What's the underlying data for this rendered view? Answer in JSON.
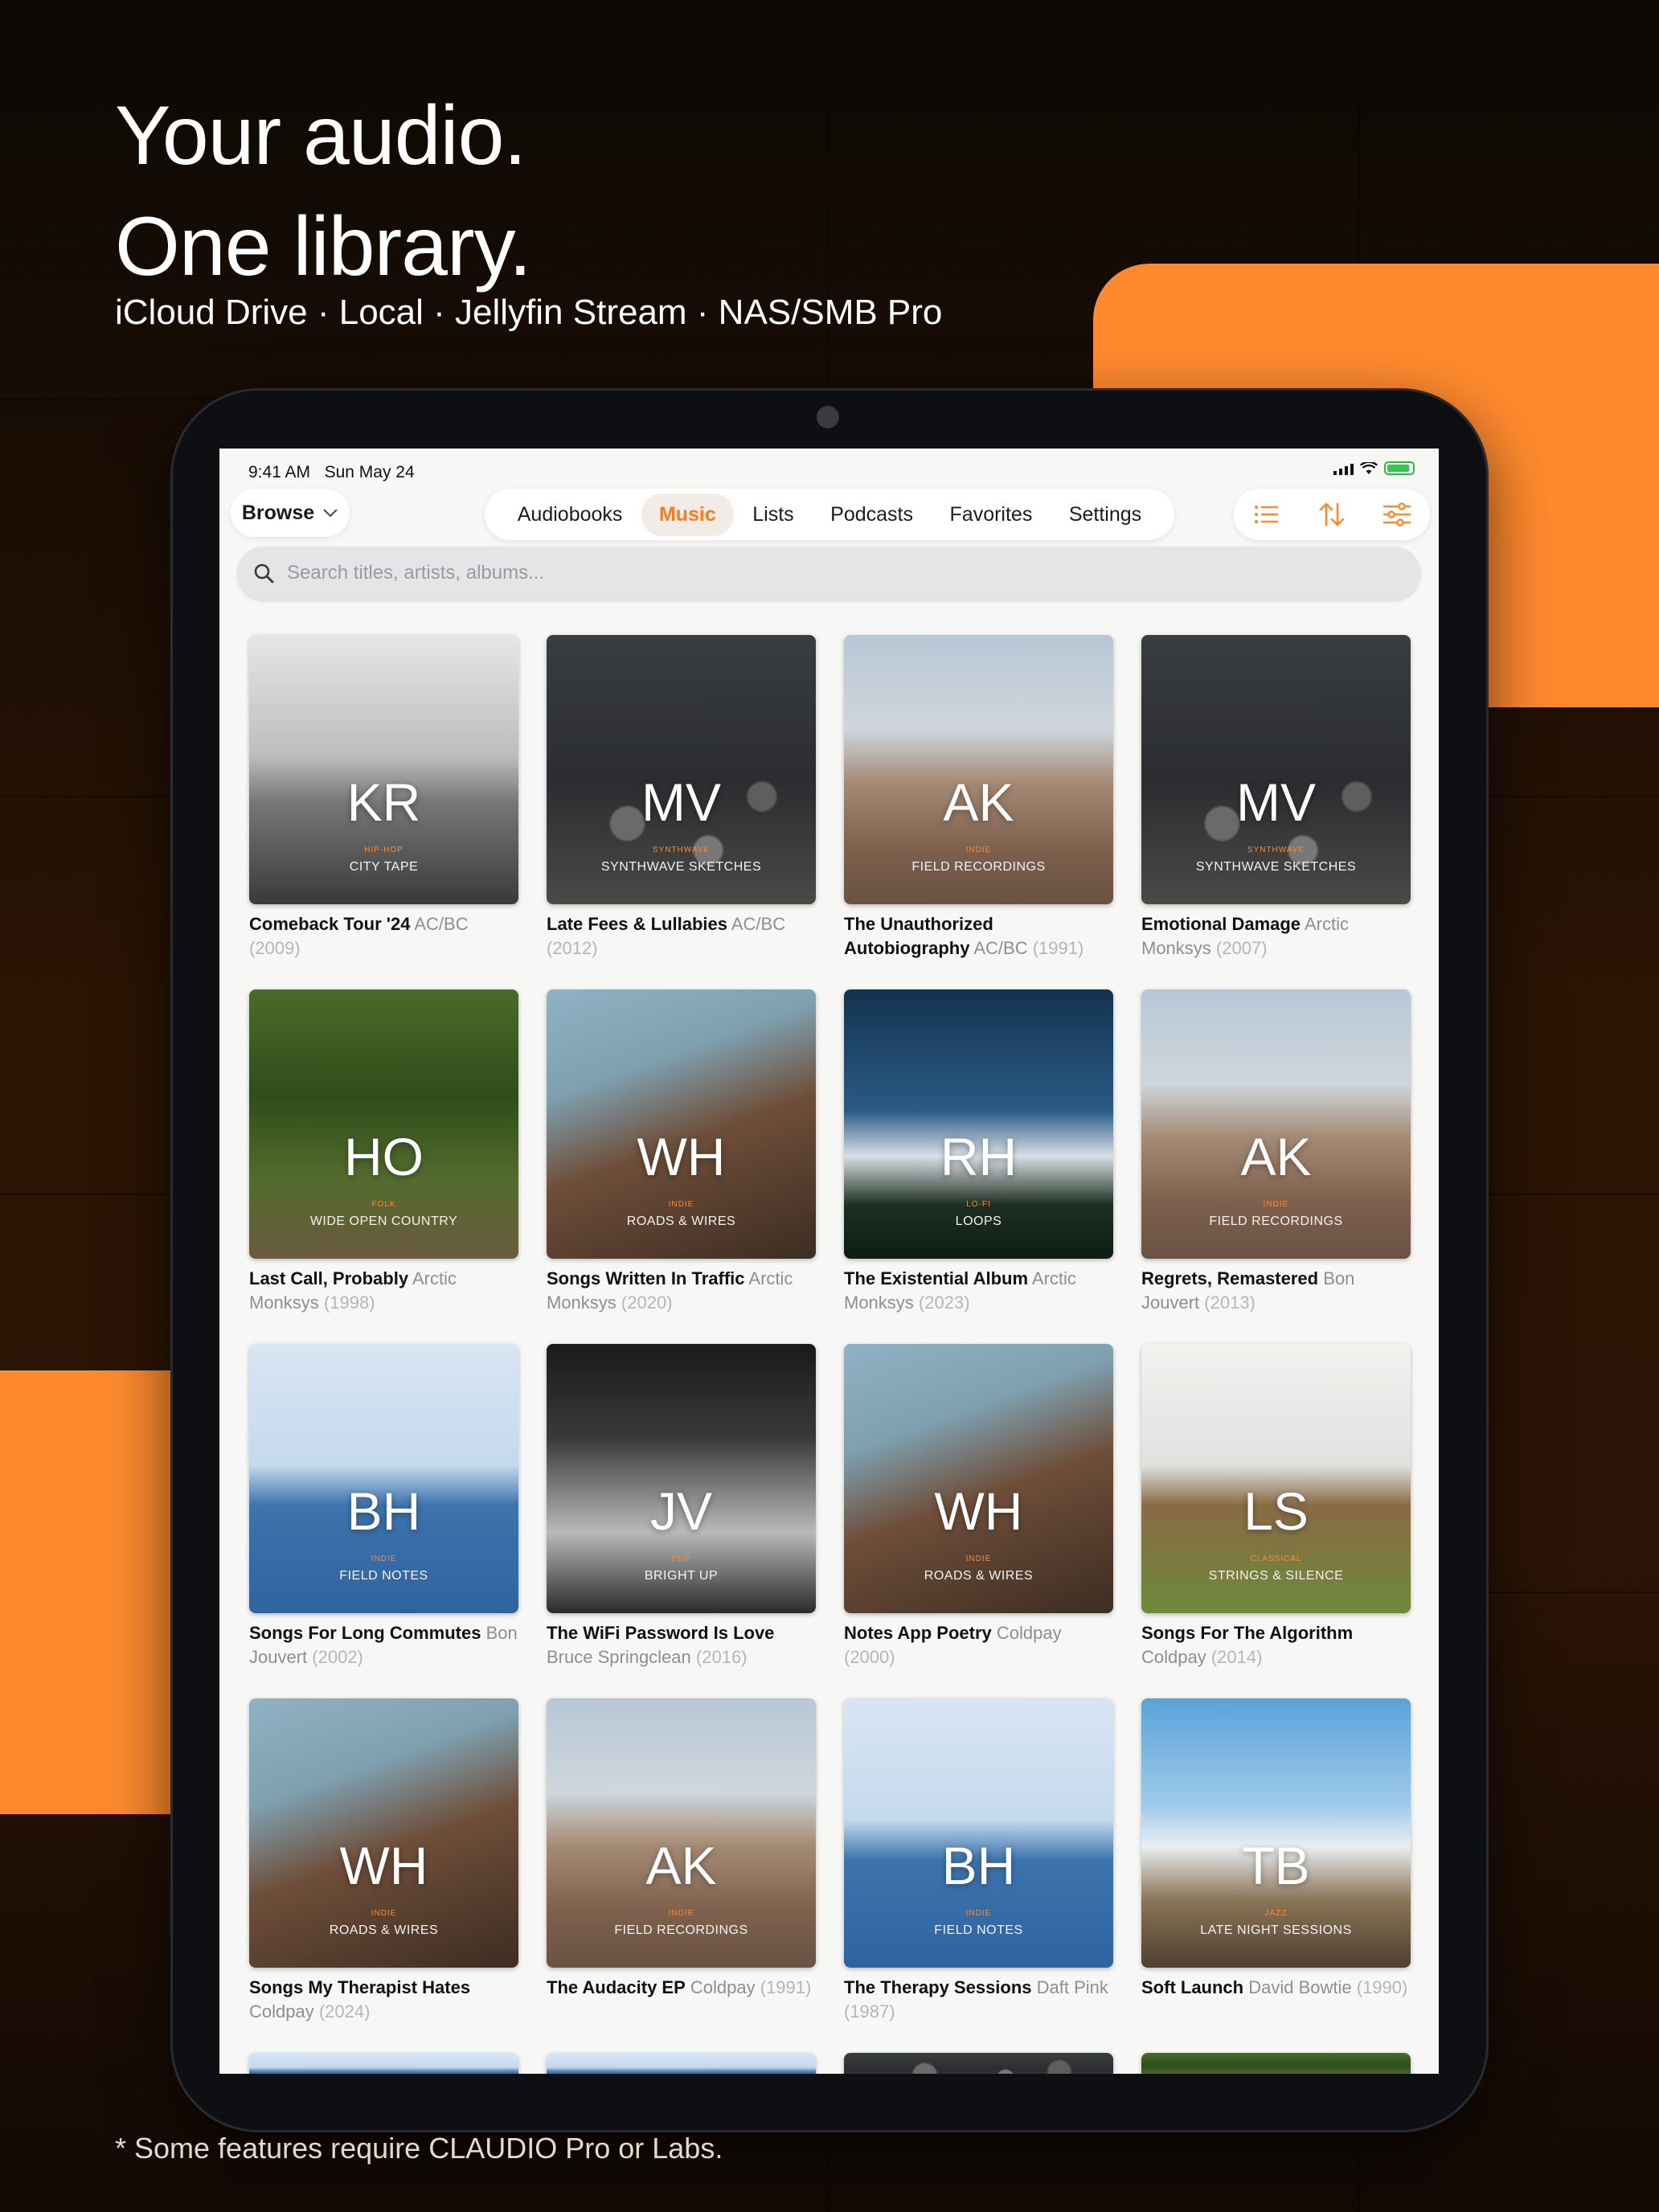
{
  "marketing": {
    "headline_line1": "Your audio.",
    "headline_line2": "One library.",
    "subhead": "iCloud Drive · Local · Jellyfin Stream · NAS/SMB Pro",
    "footnote": "* Some features require CLAUDIO Pro or Labs.",
    "colors": {
      "accent": "#ff8a2e",
      "background": "#2a1404"
    }
  },
  "status_bar": {
    "time": "9:41 AM",
    "date": "Sun May 24"
  },
  "toolbar": {
    "browse_label": "Browse",
    "tabs": [
      "Audiobooks",
      "Music",
      "Lists",
      "Podcasts",
      "Favorites",
      "Settings"
    ],
    "active_tab": "Music",
    "tools": [
      "list-icon",
      "sort-icon",
      "filter-icon"
    ]
  },
  "search": {
    "placeholder": "Search titles, artists, albums..."
  },
  "albums": [
    {
      "initials": "KR",
      "genre": "HIP-HOP",
      "sub": "CITY TAPE",
      "title": "Comeback Tour '24",
      "artist": "AC/BC",
      "year": "(2009)"
    },
    {
      "initials": "MV",
      "genre": "SYNTHWAVE",
      "sub": "SYNTHWAVE SKETCHES",
      "title": "Late Fees & Lullabies",
      "artist": "AC/BC",
      "year": "(2012)"
    },
    {
      "initials": "AK",
      "genre": "INDIE",
      "sub": "FIELD RECORDINGS",
      "title": "The Unauthorized Autobiography",
      "artist": "AC/BC",
      "year": "(1991)"
    },
    {
      "initials": "MV",
      "genre": "SYNTHWAVE",
      "sub": "SYNTHWAVE SKETCHES",
      "title": "Emotional Damage",
      "artist": "Arctic Monksys",
      "year": "(2007)"
    },
    {
      "initials": "HO",
      "genre": "FOLK",
      "sub": "WIDE OPEN COUNTRY",
      "title": "Last Call, Probably",
      "artist": "Arctic Monksys",
      "year": "(1998)"
    },
    {
      "initials": "WH",
      "genre": "INDIE",
      "sub": "ROADS & WIRES",
      "title": "Songs Written In Traffic",
      "artist": "Arctic Monksys",
      "year": "(2020)"
    },
    {
      "initials": "RH",
      "genre": "LO-FI",
      "sub": "LOOPS",
      "title": "The Existential Album",
      "artist": "Arctic Monksys",
      "year": "(2023)"
    },
    {
      "initials": "AK",
      "genre": "INDIE",
      "sub": "FIELD RECORDINGS",
      "title": "Regrets, Remastered",
      "artist": "Bon Jouvert",
      "year": "(2013)"
    },
    {
      "initials": "BH",
      "genre": "INDIE",
      "sub": "FIELD NOTES",
      "title": "Songs For Long Commutes",
      "artist": "Bon Jouvert",
      "year": "(2002)"
    },
    {
      "initials": "JV",
      "genre": "POP",
      "sub": "BRIGHT UP",
      "title": "The WiFi Password Is Love",
      "artist": "Bruce Springclean",
      "year": "(2016)"
    },
    {
      "initials": "WH",
      "genre": "INDIE",
      "sub": "ROADS & WIRES",
      "title": "Notes App Poetry",
      "artist": "Coldpay",
      "year": "(2000)"
    },
    {
      "initials": "LS",
      "genre": "CLASSICAL",
      "sub": "STRINGS & SILENCE",
      "title": "Songs For The Algorithm",
      "artist": "Coldpay",
      "year": "(2014)"
    },
    {
      "initials": "WH",
      "genre": "INDIE",
      "sub": "ROADS & WIRES",
      "title": "Songs My Therapist Hates",
      "artist": "Coldpay",
      "year": "(2024)"
    },
    {
      "initials": "AK",
      "genre": "INDIE",
      "sub": "FIELD RECORDINGS",
      "title": "The Audacity EP",
      "artist": "Coldpay",
      "year": "(1991)"
    },
    {
      "initials": "BH",
      "genre": "INDIE",
      "sub": "FIELD NOTES",
      "title": "The Therapy Sessions",
      "artist": "Daft Pink",
      "year": "(1987)"
    },
    {
      "initials": "TB",
      "genre": "JAZZ",
      "sub": "LATE NIGHT SESSIONS",
      "title": "Soft Launch",
      "artist": "David Bowtie",
      "year": "(1990)"
    }
  ]
}
